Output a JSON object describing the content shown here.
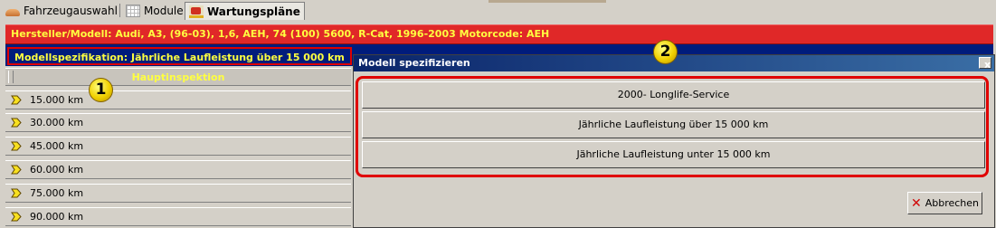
{
  "tabs": [
    {
      "label": "Fahrzeugauswahl",
      "icon": "car-icon"
    },
    {
      "label": "Module",
      "icon": "modules-icon"
    },
    {
      "label": "Wartungspläne",
      "icon": "maintenance-icon",
      "active": true
    }
  ],
  "header": {
    "vehicle": "Hersteller/Modell: Audi, A3, (96-03), 1,6, AEH, 74 (100) 5600, R-Cat, 1996-2003  Motorcode: AEH",
    "spec": "Modellspezifikation: Jährliche Laufleistung über 15 000 km"
  },
  "inspection": {
    "header": "Hauptinspektion",
    "rows": [
      "15.000 km",
      "30.000 km",
      "45.000 km",
      "60.000 km",
      "75.000 km",
      "90.000 km"
    ]
  },
  "badges": [
    "1",
    "2"
  ],
  "dialog": {
    "title": "Modell spezifizieren",
    "close": "x",
    "options": [
      "2000- Longlife-Service",
      "Jährliche Laufleistung über 15 000 km",
      "Jährliche Laufleistung unter 15 000 km"
    ],
    "cancel": "Abbrechen"
  },
  "colors": {
    "header_red": "#e02828",
    "header_text": "#ffff40",
    "spec_bar": "#001c7c",
    "highlight": "#e00000",
    "title_bar": "#0a246a"
  }
}
